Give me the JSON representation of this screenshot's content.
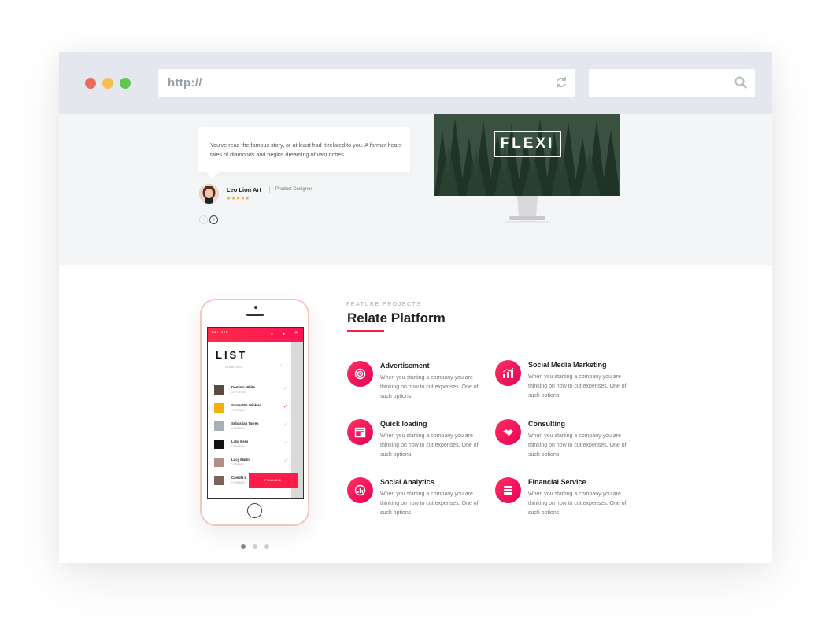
{
  "browser": {
    "url": "http://",
    "search_placeholder": ""
  },
  "colors": {
    "accent": "#ff1c48",
    "dot_red": "#ed6b5a",
    "dot_yellow": "#f5be4f",
    "dot_green": "#62c654",
    "stars": "#f5a623"
  },
  "testimonial": {
    "quote": "You've read the famous story, or at least had it related to you. A farmer hears tales of diamonds and begins dreaming of vast riches.",
    "author": "Leo Lion Art",
    "role": "Product Designer",
    "rating": 5,
    "stars": "★★★★★",
    "prev_icon": "chevron-left-icon",
    "next_icon": "chevron-right-icon"
  },
  "monitor": {
    "brand": "FLEXI"
  },
  "phone": {
    "logo": "REL ATE",
    "list_title": "LIST",
    "list_subtitle": "24 MATCHES",
    "follow_label": "FOLLOW",
    "rows": [
      {
        "name": "Dominic White",
        "sub": "12 FRIENDS"
      },
      {
        "name": "Samantha Winkler",
        "sub": "4 FRIENDS"
      },
      {
        "name": "Sebastian Torres",
        "sub": "8 FRIENDS"
      },
      {
        "name": "Lidia Berg",
        "sub": "6 FRIENDS"
      },
      {
        "name": "Lucy Martin",
        "sub": "2 FRIENDS"
      },
      {
        "name": "Camilla L",
        "sub": "9 FRIENDS"
      }
    ]
  },
  "section": {
    "kicker": "FEATURE PROJECTS",
    "title": "Relate Platform"
  },
  "features": [
    {
      "title": "Advertisement",
      "text": "When you starting a company you are thinking on how to cut expenses. One of such options.",
      "icon": "target-icon"
    },
    {
      "title": "Social Media Marketing",
      "text": "When you starting a company you are thinking on how to cut expenses. One of such options.",
      "icon": "chart-icon"
    },
    {
      "title": "Quick loading",
      "text": "When you starting a company you are thinking on how to cut expenses. One of such options.",
      "icon": "calendar-icon"
    },
    {
      "title": "Consulting",
      "text": "When you starting a company you are thinking on how to cut expenses. One of such options.",
      "icon": "handshake-icon"
    },
    {
      "title": "Social Analytics",
      "text": "When you starting a company you are thinking on how to cut expenses. One of such options.",
      "icon": "analytics-icon"
    },
    {
      "title": "Financial Service",
      "text": "When you starting a company you are thinking on how to cut expenses. One of such options.",
      "icon": "coins-icon"
    }
  ]
}
